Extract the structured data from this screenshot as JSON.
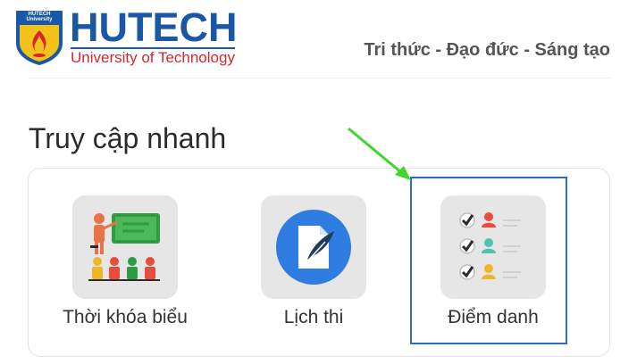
{
  "header": {
    "logo_text": "HUTECH University",
    "brand_name": "HUTECH",
    "brand_subtitle": "University of Technology",
    "slogan": "Tri thức - Đạo đức - Sáng tạo"
  },
  "quick_access": {
    "title": "Truy cập nhanh",
    "items": [
      {
        "label": "Thời khóa biểu",
        "icon": "timetable-teacher-icon"
      },
      {
        "label": "Lịch thi",
        "icon": "exam-document-quill-icon"
      },
      {
        "label": "Điểm danh",
        "icon": "attendance-checklist-icon"
      }
    ]
  },
  "annotation": {
    "highlight_color": "#2a6fc4",
    "arrow_color": "#3ed62a"
  },
  "colors": {
    "brand_blue": "#1a57a6",
    "brand_red": "#d8262e",
    "tile_bg": "#e6e6e6"
  }
}
